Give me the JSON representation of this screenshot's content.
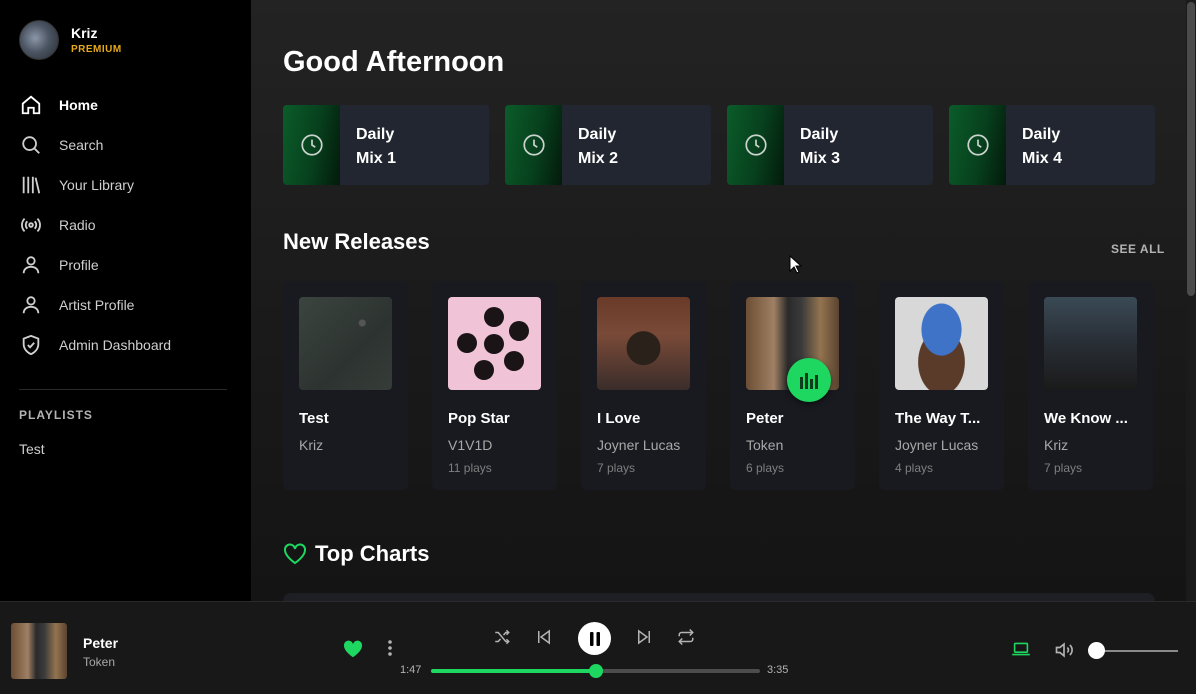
{
  "user": {
    "name": "Kriz",
    "tier": "PREMIUM"
  },
  "nav": [
    {
      "label": "Home",
      "icon": "home-icon",
      "active": true
    },
    {
      "label": "Search",
      "icon": "search-icon"
    },
    {
      "label": "Your Library",
      "icon": "library-icon"
    },
    {
      "label": "Radio",
      "icon": "radio-icon"
    },
    {
      "label": "Profile",
      "icon": "user-icon"
    },
    {
      "label": "Artist Profile",
      "icon": "user-icon"
    },
    {
      "label": "Admin Dashboard",
      "icon": "shield-icon"
    }
  ],
  "playlists": {
    "heading": "PLAYLISTS",
    "items": [
      "Test"
    ]
  },
  "main": {
    "greeting": "Good Afternoon",
    "mixes": [
      {
        "line1": "Daily",
        "line2": "Mix 1"
      },
      {
        "line1": "Daily",
        "line2": "Mix 2"
      },
      {
        "line1": "Daily",
        "line2": "Mix 3"
      },
      {
        "line1": "Daily",
        "line2": "Mix 4"
      }
    ],
    "new_releases": {
      "title": "New Releases",
      "see_all": "SEE ALL",
      "items": [
        {
          "title": "Test",
          "artist": "Kriz",
          "plays": ""
        },
        {
          "title": "Pop Star",
          "artist": "V1V1D",
          "plays": "11 plays"
        },
        {
          "title": "I Love",
          "artist": "Joyner Lucas",
          "plays": "7 plays"
        },
        {
          "title": "Peter",
          "artist": "Token",
          "plays": "6 plays",
          "playing": true
        },
        {
          "title": "The Way T...",
          "artist": "Joyner Lucas",
          "plays": "4 plays"
        },
        {
          "title": "We Know ...",
          "artist": "Kriz",
          "plays": "7 plays"
        }
      ]
    },
    "top_charts": {
      "title": "Top Charts"
    }
  },
  "player": {
    "title": "Peter",
    "artist": "Token",
    "liked": true,
    "current_time": "1:47",
    "total_time": "3:35",
    "progress": 0.5,
    "volume": 0.05
  },
  "colors": {
    "accent": "#1ed760",
    "premium": "#e6a91a"
  }
}
